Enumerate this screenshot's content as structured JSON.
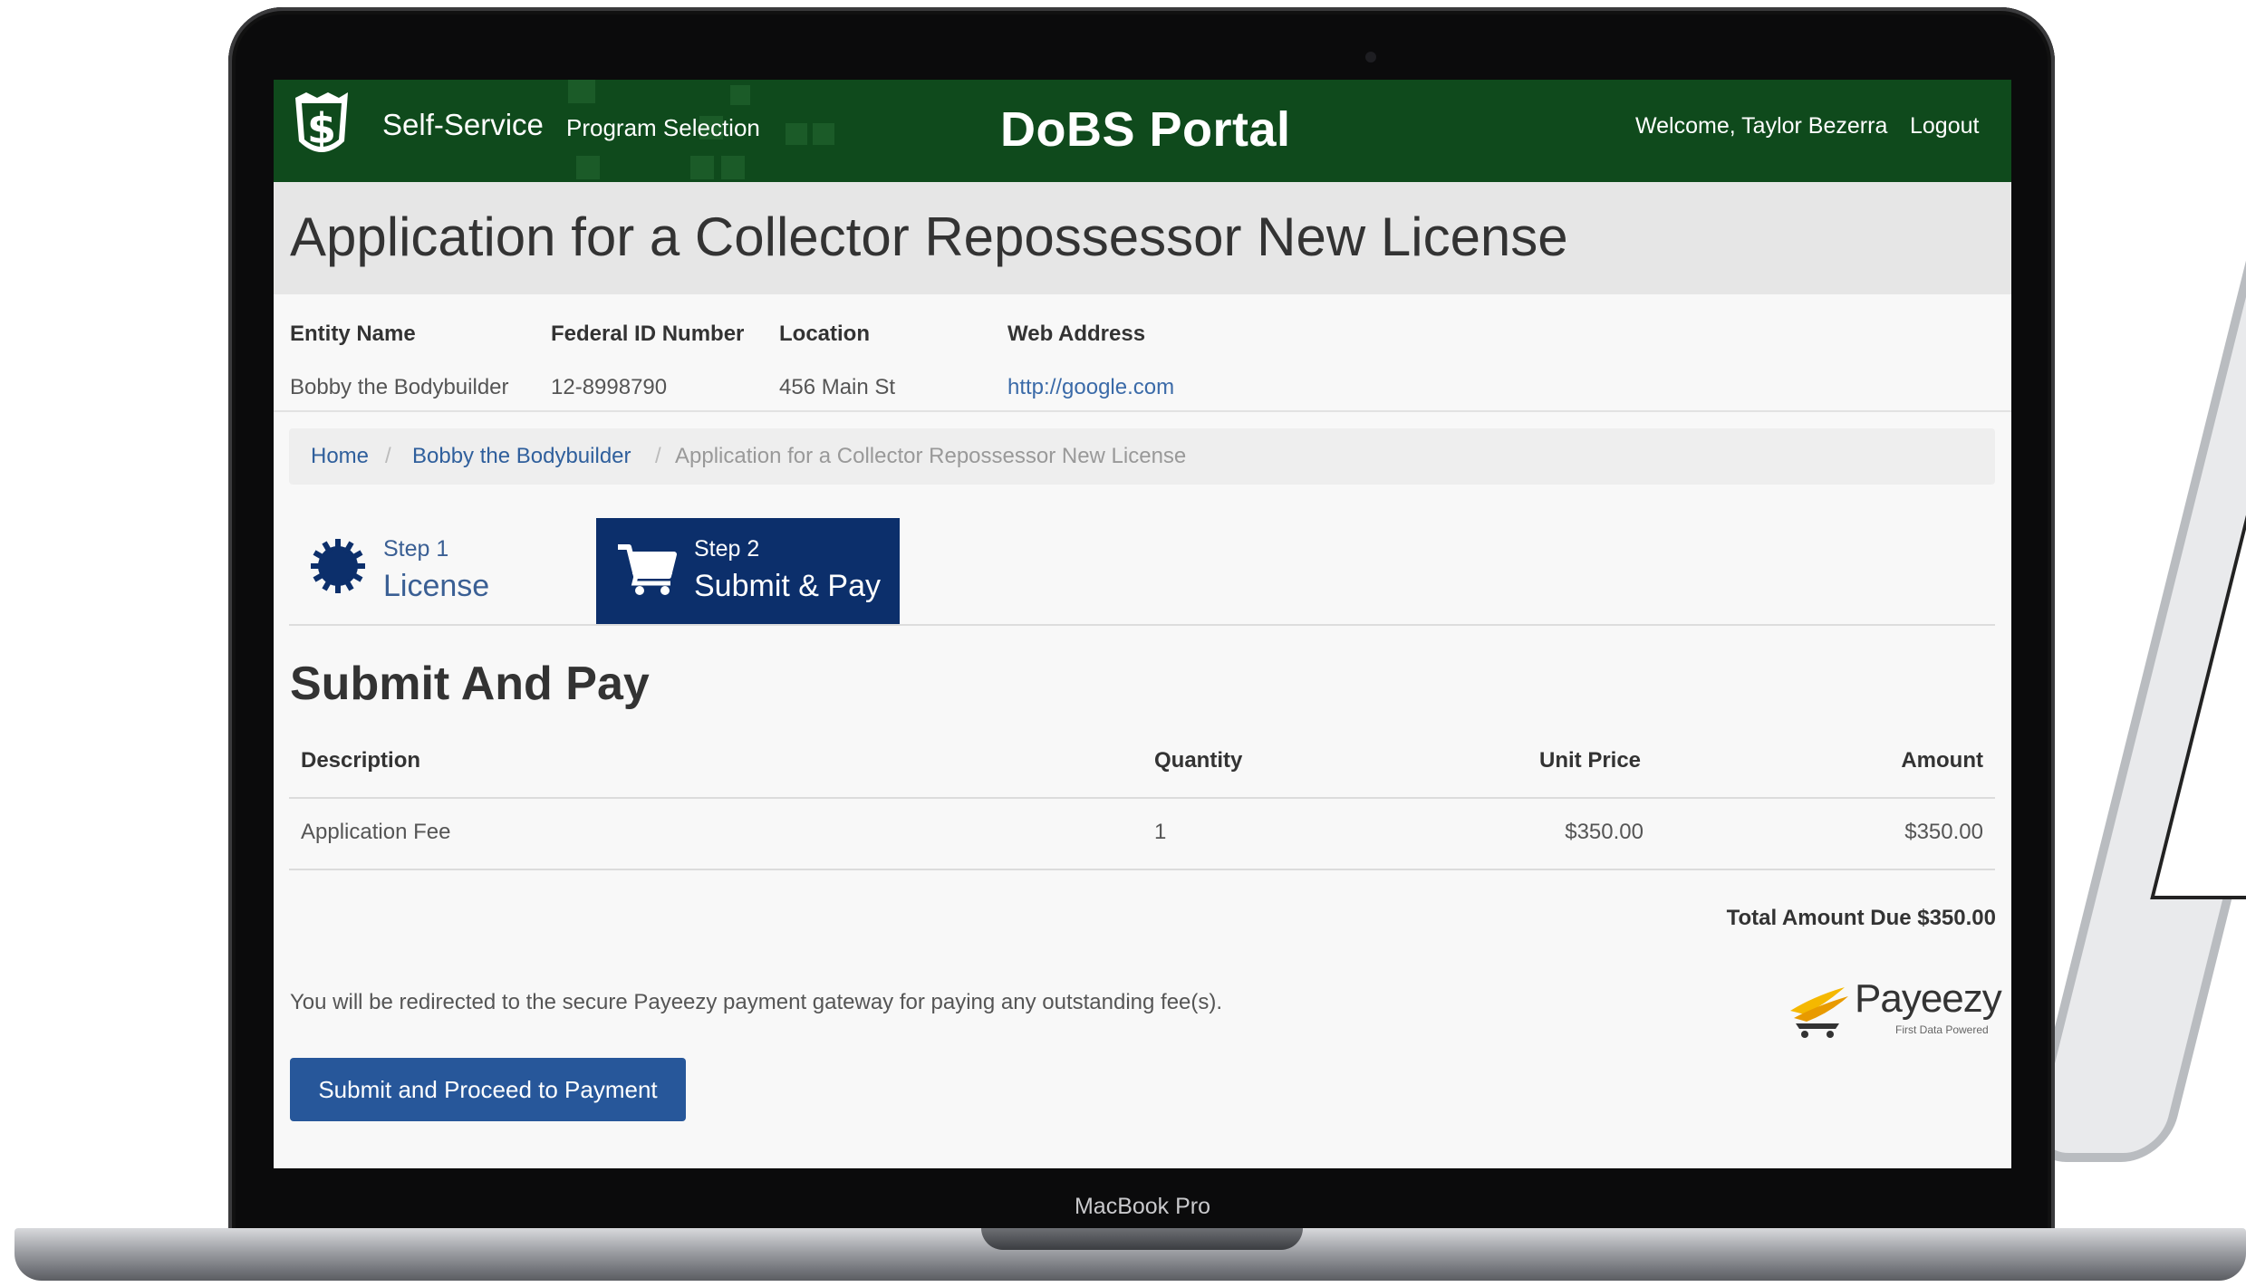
{
  "device": {
    "label": "MacBook Pro"
  },
  "navbar": {
    "logo_icon": "dollar-seal-logo",
    "self_service": "Self-Service",
    "program_selection": "Program Selection",
    "portal_title": "DoBS Portal",
    "welcome": "Welcome, Taylor Bezerra",
    "logout": "Logout",
    "colors": {
      "background": "#0f4a1c"
    }
  },
  "page": {
    "title": "Application for a Collector Repossessor New License"
  },
  "entity": {
    "headers": {
      "entity_name": "Entity Name",
      "federal_id": "Federal ID Number",
      "location": "Location",
      "web_address": "Web Address"
    },
    "values": {
      "entity_name": "Bobby the Bodybuilder",
      "federal_id": "12-8998790",
      "location": "456 Main St",
      "web_address": "http://google.com"
    }
  },
  "breadcrumb": {
    "items": [
      "Home",
      "Bobby the Bodybuilder",
      "Application for a Collector Repossessor New License"
    ],
    "separator": "/"
  },
  "steps": [
    {
      "number": "Step 1",
      "label": "License",
      "icon": "gear-badge-icon",
      "active": false
    },
    {
      "number": "Step 2",
      "label": "Submit & Pay",
      "icon": "shopping-cart-icon",
      "active": true
    }
  ],
  "section": {
    "title": "Submit And Pay"
  },
  "fee_table": {
    "headers": {
      "description": "Description",
      "quantity": "Quantity",
      "unit_price": "Unit Price",
      "amount": "Amount"
    },
    "rows": [
      {
        "description": "Application Fee",
        "quantity": "1",
        "unit_price": "$350.00",
        "amount": "$350.00"
      }
    ]
  },
  "total_due": "Total Amount Due $350.00",
  "redirect_note": "You will be redirected to the secure Payeezy payment gateway for paying any outstanding fee(s).",
  "payeezy": {
    "name": "Payeezy",
    "tagline": "First Data Powered"
  },
  "submit_button": "Submit and Proceed to Payment",
  "colors": {
    "accent": "#0c2f6b",
    "button": "#27579a",
    "link": "#2f5f9c"
  }
}
